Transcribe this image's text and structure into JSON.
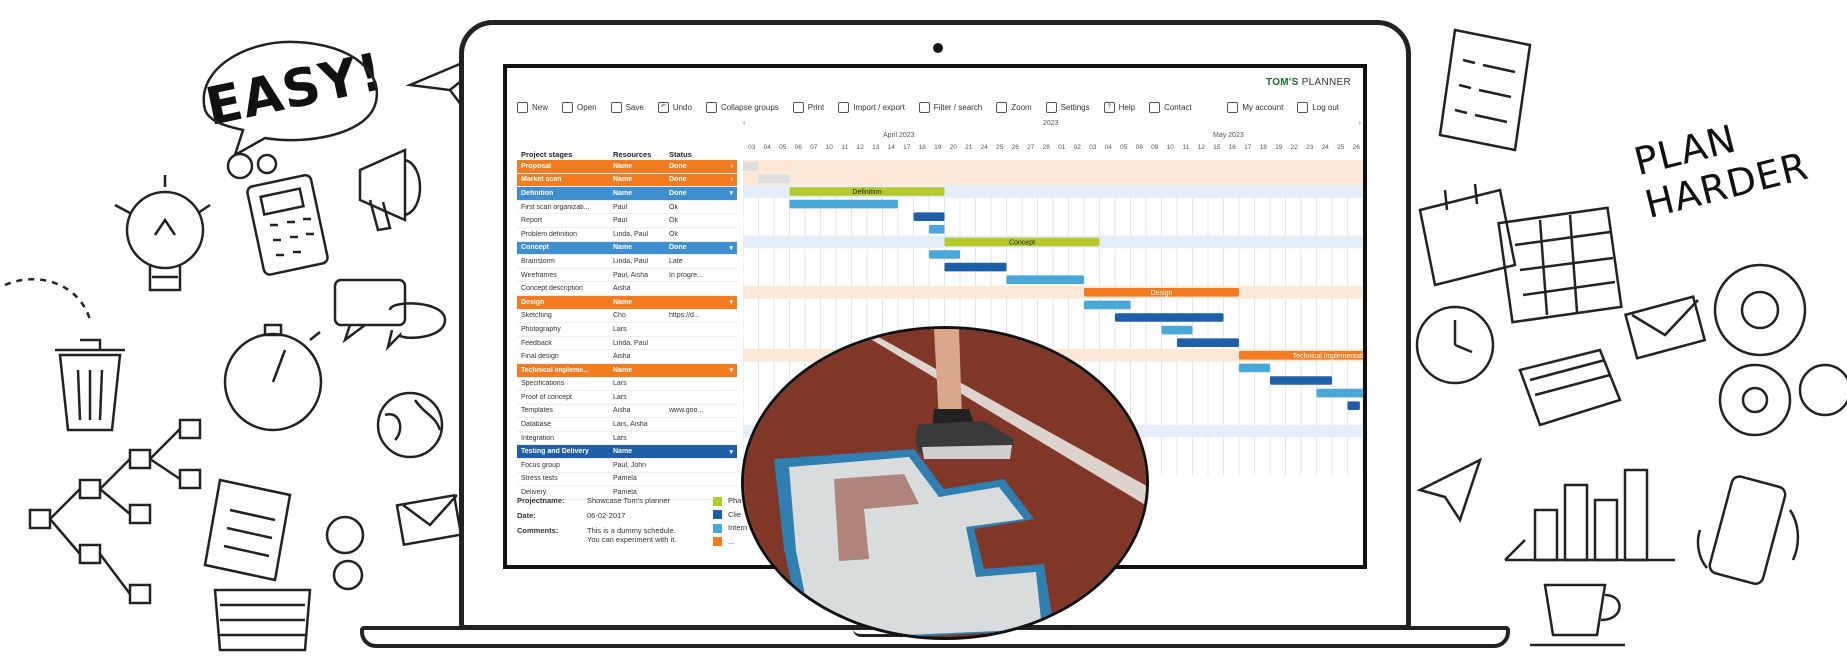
{
  "brand": {
    "bold": "TOM'S",
    "rest": "PLANNER"
  },
  "doodles": {
    "easy": "EASY!",
    "plan_line1": "PLAN",
    "plan_line2": "HARDER"
  },
  "toolbar": {
    "items": [
      "New",
      "Open",
      "Save",
      "Undo",
      "Collapse groups",
      "Print",
      "Import / export",
      "Filter / search",
      "Zoom",
      "Settings",
      "Help",
      "Contact"
    ],
    "right": [
      "My account",
      "Log out"
    ]
  },
  "columns": {
    "stages": "Project stages",
    "resources": "Resources",
    "status": "Status"
  },
  "dates": {
    "year": "2023",
    "month1": "April 2023",
    "month2": "May 2023",
    "days": [
      "03",
      "04",
      "05",
      "06",
      "07",
      "10",
      "11",
      "12",
      "13",
      "14",
      "17",
      "18",
      "19",
      "20",
      "21",
      "24",
      "25",
      "26",
      "27",
      "28",
      "01",
      "02",
      "03",
      "04",
      "05",
      "08",
      "09",
      "10",
      "11",
      "12",
      "15",
      "16",
      "17",
      "18",
      "19",
      "22",
      "23",
      "24",
      "25",
      "26"
    ]
  },
  "rows": [
    {
      "stage": "Proposal",
      "res": "Name",
      "status": "Done",
      "group": "orange"
    },
    {
      "stage": "Market scan",
      "res": "Name",
      "status": "Done",
      "group": "orange"
    },
    {
      "stage": "Definition",
      "res": "Name",
      "status": "Done",
      "group": "blue"
    },
    {
      "stage": "First scan organizati...",
      "res": "Paul",
      "status": "Ok"
    },
    {
      "stage": "Report",
      "res": "Paul",
      "status": "Ok"
    },
    {
      "stage": "Problem definition",
      "res": "Linda, Paul",
      "status": "Ok"
    },
    {
      "stage": "Concept",
      "res": "Name",
      "status": "Done",
      "group": "blue"
    },
    {
      "stage": "Brainstorm",
      "res": "Linda, Paul",
      "status": "Late"
    },
    {
      "stage": "Wireframes",
      "res": "Paul, Aisha",
      "status": "In progre..."
    },
    {
      "stage": "Concept description",
      "res": "Aisha",
      "status": ""
    },
    {
      "stage": "Design",
      "res": "Name",
      "status": "",
      "group": "orange"
    },
    {
      "stage": "Sketching",
      "res": "Cho",
      "status": "https://d..."
    },
    {
      "stage": "Photography",
      "res": "Lars",
      "status": ""
    },
    {
      "stage": "Feedback",
      "res": "Linda, Paul",
      "status": ""
    },
    {
      "stage": "Final design",
      "res": "Aisha",
      "status": ""
    },
    {
      "stage": "Technical impleme...",
      "res": "Name",
      "status": "",
      "group": "orange"
    },
    {
      "stage": "Specifications",
      "res": "Lars",
      "status": ""
    },
    {
      "stage": "Proof of concept",
      "res": "Lars",
      "status": ""
    },
    {
      "stage": "Templates",
      "res": "Aisha",
      "status": "www.goo..."
    },
    {
      "stage": "Database",
      "res": "Lars, Aisha",
      "status": ""
    },
    {
      "stage": "Integration",
      "res": "Lars",
      "status": ""
    },
    {
      "stage": "Testing and Delivery",
      "res": "Name",
      "status": "",
      "group": "darkblue"
    },
    {
      "stage": "Focus group",
      "res": "Paul, John",
      "status": ""
    },
    {
      "stage": "Stress tests",
      "res": "Pamela",
      "status": ""
    },
    {
      "stage": "Delivery",
      "res": "Pamela",
      "status": ""
    }
  ],
  "bar_labels": {
    "definition": "Definition",
    "concept": "Concept",
    "design": "Design",
    "tech": "Technical implementation"
  },
  "legend": {
    "projectname_label": "Projectname:",
    "projectname": "Showcase Tom's planner",
    "date_label": "Date:",
    "date": "06-02-2017",
    "comments_label": "Comments:",
    "comments1": "This is a dummy schedule.",
    "comments2": "You can experiment with it.",
    "keys": [
      "Pha",
      "Clie",
      "Intern",
      "..."
    ]
  },
  "colors": {
    "orange": "#f47c20",
    "blue": "#3d8fd1",
    "darkblue": "#1f5fa8",
    "green": "#b5c92a",
    "lightblue": "#4aa8d8"
  }
}
